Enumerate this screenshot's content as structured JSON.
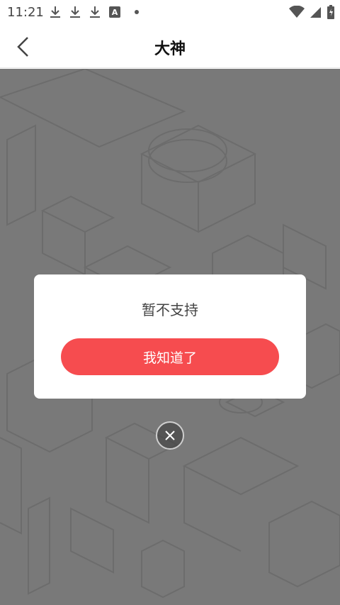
{
  "status_bar": {
    "time": "11:21",
    "left_icons": [
      "download-icon",
      "download-icon",
      "download-icon",
      "a-icon",
      "dot-icon"
    ],
    "a_icon_label": "A",
    "right_icons": [
      "wifi-icon",
      "signal-icon",
      "battery-icon"
    ]
  },
  "nav": {
    "title": "大神",
    "back_icon": "chevron-left-icon"
  },
  "dialog": {
    "message": "暂不支持",
    "button_label": "我知道了",
    "button_color": "#f64c4f"
  },
  "close": {
    "icon": "close-icon"
  },
  "colors": {
    "overlay": "rgba(0,0,0,0.5)",
    "accent": "#f64c4f"
  }
}
